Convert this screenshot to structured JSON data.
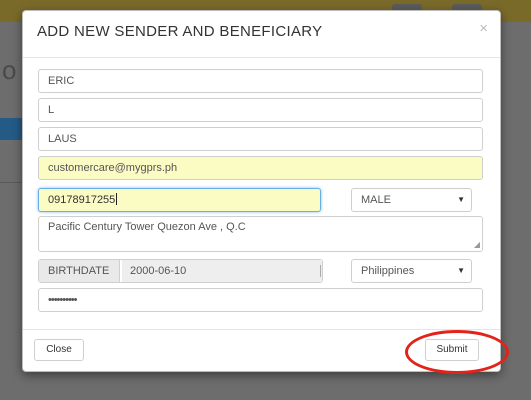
{
  "modal": {
    "title": "ADD NEW SENDER AND BENEFICIARY",
    "close_icon": "×"
  },
  "form": {
    "first_name": "ERIC",
    "middle_name": "L",
    "last_name": "LAUS",
    "email": "customercare@mygprs.ph",
    "phone": "09178917255",
    "gender": "MALE",
    "address": "Pacific Century Tower Quezon Ave , Q.C",
    "birthdate_label": "BIRTHDATE",
    "birthdate": "2000-06-10",
    "country": "Philippines",
    "password": "••••••••••"
  },
  "footer": {
    "close_label": "Close",
    "submit_label": "Submit"
  },
  "icons": {
    "select_arrow": "▼",
    "resize_grip": "◢"
  },
  "colors": {
    "autofill_yellow": "#fbfbc4",
    "focus_blue": "#66afe9",
    "annotation_red": "#e2231a"
  }
}
